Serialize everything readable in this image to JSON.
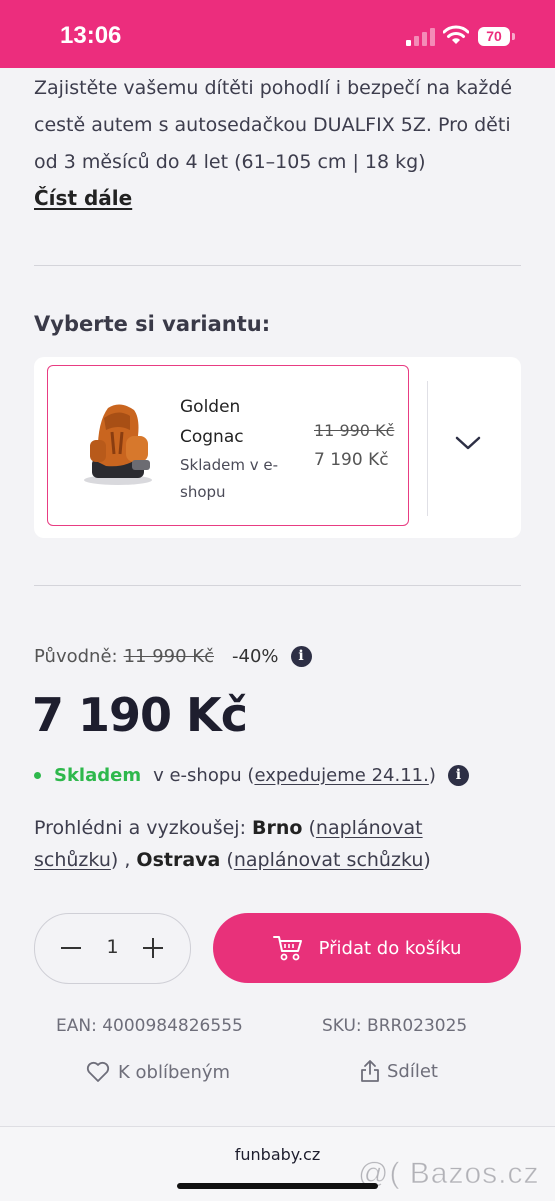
{
  "status_bar": {
    "time": "13:06",
    "battery": "70"
  },
  "description": {
    "text": "Zajistěte vašemu dítěti pohodlí i bezpečí na každé cestě autem s autosedačkou DUALFIX 5Z. Pro děti od 3 měsíců do 4 let (61–105 cm | 18 kg)",
    "read_more": "Číst dále"
  },
  "variant": {
    "heading": "Vyberte si variantu:",
    "name": "Golden Cognac",
    "stock": "Skladem v e-shopu",
    "old_price": "11 990 Kč",
    "new_price": "7 190 Kč"
  },
  "pricing": {
    "original_label": "Původně:",
    "original_price": "11 990 Kč",
    "discount": "-40%",
    "price": "7 190 Kč"
  },
  "availability": {
    "in_stock": "Skladem",
    "location": "v e-shopu (",
    "shipping": "expedujeme 24.11.",
    "close": ")"
  },
  "visit": {
    "label": "Prohlédni a vyzkoušej: ",
    "city1": "Brno",
    "link1": "naplánovat schůzku",
    "sep": " , ",
    "city2": "Ostrava",
    "link2": "naplánovat schůzku"
  },
  "cart": {
    "quantity": "1",
    "add_label": "Přidat do košíku"
  },
  "codes": {
    "ean": "EAN: 4000984826555",
    "sku": "SKU: BRR023025"
  },
  "actions": {
    "favorite": "K oblíbeným",
    "share": "Sdílet"
  },
  "footer": {
    "domain": "funbaby.cz",
    "watermark": "@( Bazos.cz"
  },
  "colors": {
    "brand": "#ec2d7d",
    "in_stock": "#2eb84c"
  }
}
